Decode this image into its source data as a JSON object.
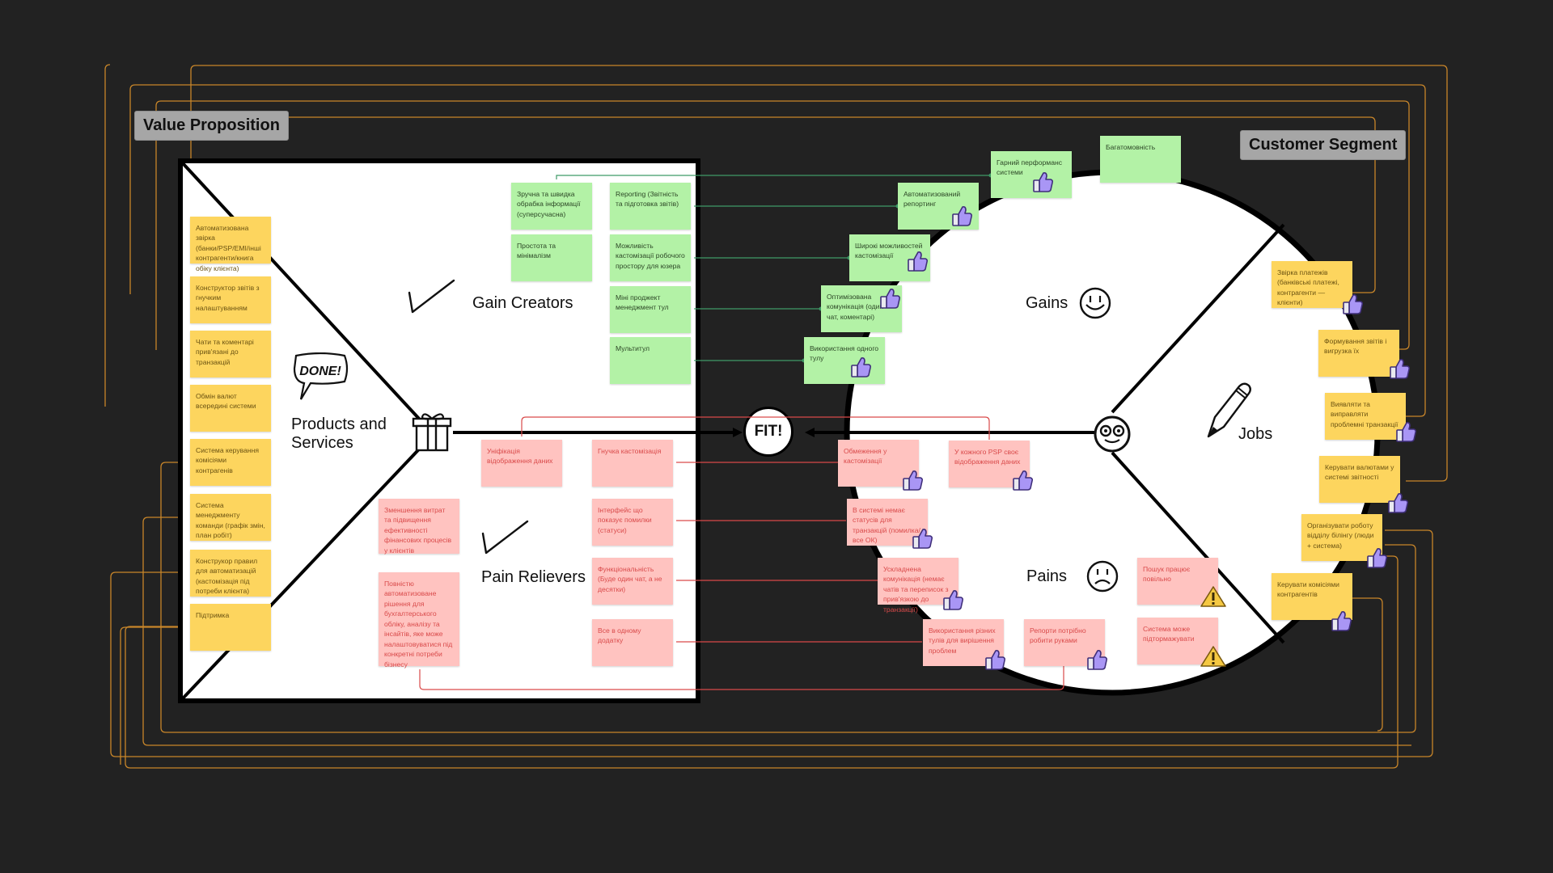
{
  "canvas": {
    "background": "#222222",
    "connector_color": "#c8862a"
  },
  "colors": {
    "yellow_sticky": "#fdd55e",
    "green_sticky": "#b3f2a6",
    "pink_sticky": "#ffc3c0",
    "pink_text": "#d94a4a",
    "thumb_purple": "#a996f5",
    "warning_yellow": "#f5c842"
  },
  "labels": {
    "value_proposition": "Value Proposition",
    "customer_segment": "Customer Segment"
  },
  "value_proposition": {
    "products_and_services": {
      "title_line1": "Products and",
      "title_line2": "Services",
      "badge": "DONE!",
      "items": [
        "Автоматизована звірка (банки/PSP/EMI/інші контрагенти/книга обіку клієнта)",
        "Конструктор звітів з гнучким налаштуванням",
        "Чати та коментарі прив'язані до транзакцій",
        "Обмін валют всередині системи",
        "Система керування комісіями контрагенів",
        "Система менеджменту команди (графік змін, план робіт)",
        "Конструкор правил для автоматизацій (кастомізація під потреби клієнта)",
        "Підтримка"
      ]
    },
    "gain_creators": {
      "title": "Gain Creators",
      "items": [
        "Зручна та швидка обрабка інформації (суперсучасна)",
        "Простота та мінімалізм",
        "Reporting (Звітність та підготовка звітів)",
        "Можливість кастомізації робочого простору для юзера",
        "Міні проджект менеджмент тул",
        "Мультитул"
      ]
    },
    "pain_relievers": {
      "title": "Pain Relievers",
      "items": [
        "Уніфікація відображення даних",
        "Гнучка кастомізація",
        "Зменшення витрат та підвищення ефективності фінансових процесів у клієнтів",
        "Інтерфейс що показує помилки (статуси)",
        "Функціональність (Буде один чат, а не десятки)",
        "Повністю автоматизоване рішення для бухгалтерського обліку, аналізу та інсайтів, яке може налаштовуватися під конкретні потреби бізнесу",
        "Все в одному додатку"
      ]
    }
  },
  "fit_label": "FIT!",
  "customer_segment": {
    "gains": {
      "title": "Gains",
      "items": [
        "Багатомовність",
        "Гарний перформанс системи",
        "Автоматизований репортинг",
        "Широкі можливостей кастомізації",
        "Оптимізована комунікація (один чат, коментарі)",
        "Використання одного тулу"
      ]
    },
    "pains": {
      "title": "Pains",
      "items": [
        "Обмеження у кастомізації",
        "У кожного PSP своє відображення даних",
        "В системі немає статусів для транзакцій (помилка/все ОК)",
        "Ускладнена комунікація (немає чатів та переписок з прив'язкою до транзакції)",
        "Пошук працює повільно",
        "Використання різних тулів для вирішення проблем",
        "Репорти потрібно робити руками",
        "Система може підтормажувати"
      ]
    },
    "jobs": {
      "title": "Jobs",
      "items": [
        "Звірка платежів (банківські платежі, контрагенти — клієнти)",
        "Формування звітів і вигрузка їх",
        "Виявляти та виправляти проблемні транзакції",
        "Керувати валютами у системі звітності",
        "Організувати роботу відділу білінгу (люди + система)",
        "Керувати комісіями контрагентів"
      ]
    }
  },
  "icons": {
    "like": "thumbs-up-icon",
    "warning": "warning-icon",
    "gift": "gift-icon",
    "check": "checkmark-icon",
    "smile": "smiley-icon",
    "sad": "sad-face-icon",
    "nerd": "glasses-face-icon",
    "pencil": "pencil-icon",
    "speech": "speech-bubble-icon"
  }
}
